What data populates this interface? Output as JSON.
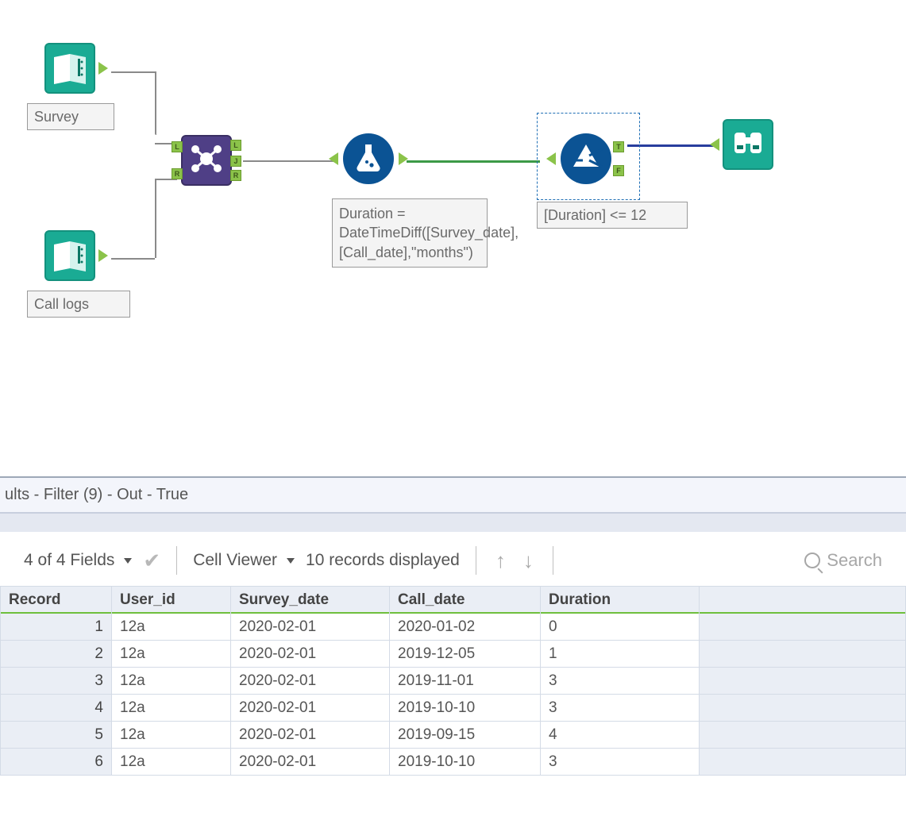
{
  "nodes": {
    "survey": {
      "label": "Survey"
    },
    "calllogs": {
      "label": "Call logs"
    },
    "join": {
      "anchors_in": [
        "L",
        "R"
      ],
      "anchors_out": [
        "L",
        "J",
        "R"
      ]
    },
    "formula": {
      "annotation": "Duration = DateTimeDiff([Survey_date],[Call_date],\"months\")"
    },
    "filter": {
      "annotation": "[Duration] <= 12",
      "anchors_out": [
        "T",
        "F"
      ]
    },
    "browse": {}
  },
  "results": {
    "title": "ults - Filter (9) - Out - True",
    "fields_label": "4 of 4 Fields",
    "cell_viewer_label": "Cell Viewer",
    "records_label": "10 records displayed",
    "search_placeholder": "Search",
    "columns": [
      "Record",
      "User_id",
      "Survey_date",
      "Call_date",
      "Duration"
    ],
    "rows": [
      {
        "Record": "1",
        "User_id": "12a",
        "Survey_date": "2020-02-01",
        "Call_date": "2020-01-02",
        "Duration": "0"
      },
      {
        "Record": "2",
        "User_id": "12a",
        "Survey_date": "2020-02-01",
        "Call_date": "2019-12-05",
        "Duration": "1"
      },
      {
        "Record": "3",
        "User_id": "12a",
        "Survey_date": "2020-02-01",
        "Call_date": "2019-11-01",
        "Duration": "3"
      },
      {
        "Record": "4",
        "User_id": "12a",
        "Survey_date": "2020-02-01",
        "Call_date": "2019-10-10",
        "Duration": "3"
      },
      {
        "Record": "5",
        "User_id": "12a",
        "Survey_date": "2020-02-01",
        "Call_date": "2019-09-15",
        "Duration": "4"
      },
      {
        "Record": "6",
        "User_id": "12a",
        "Survey_date": "2020-02-01",
        "Call_date": "2019-10-10",
        "Duration": "3"
      }
    ]
  }
}
